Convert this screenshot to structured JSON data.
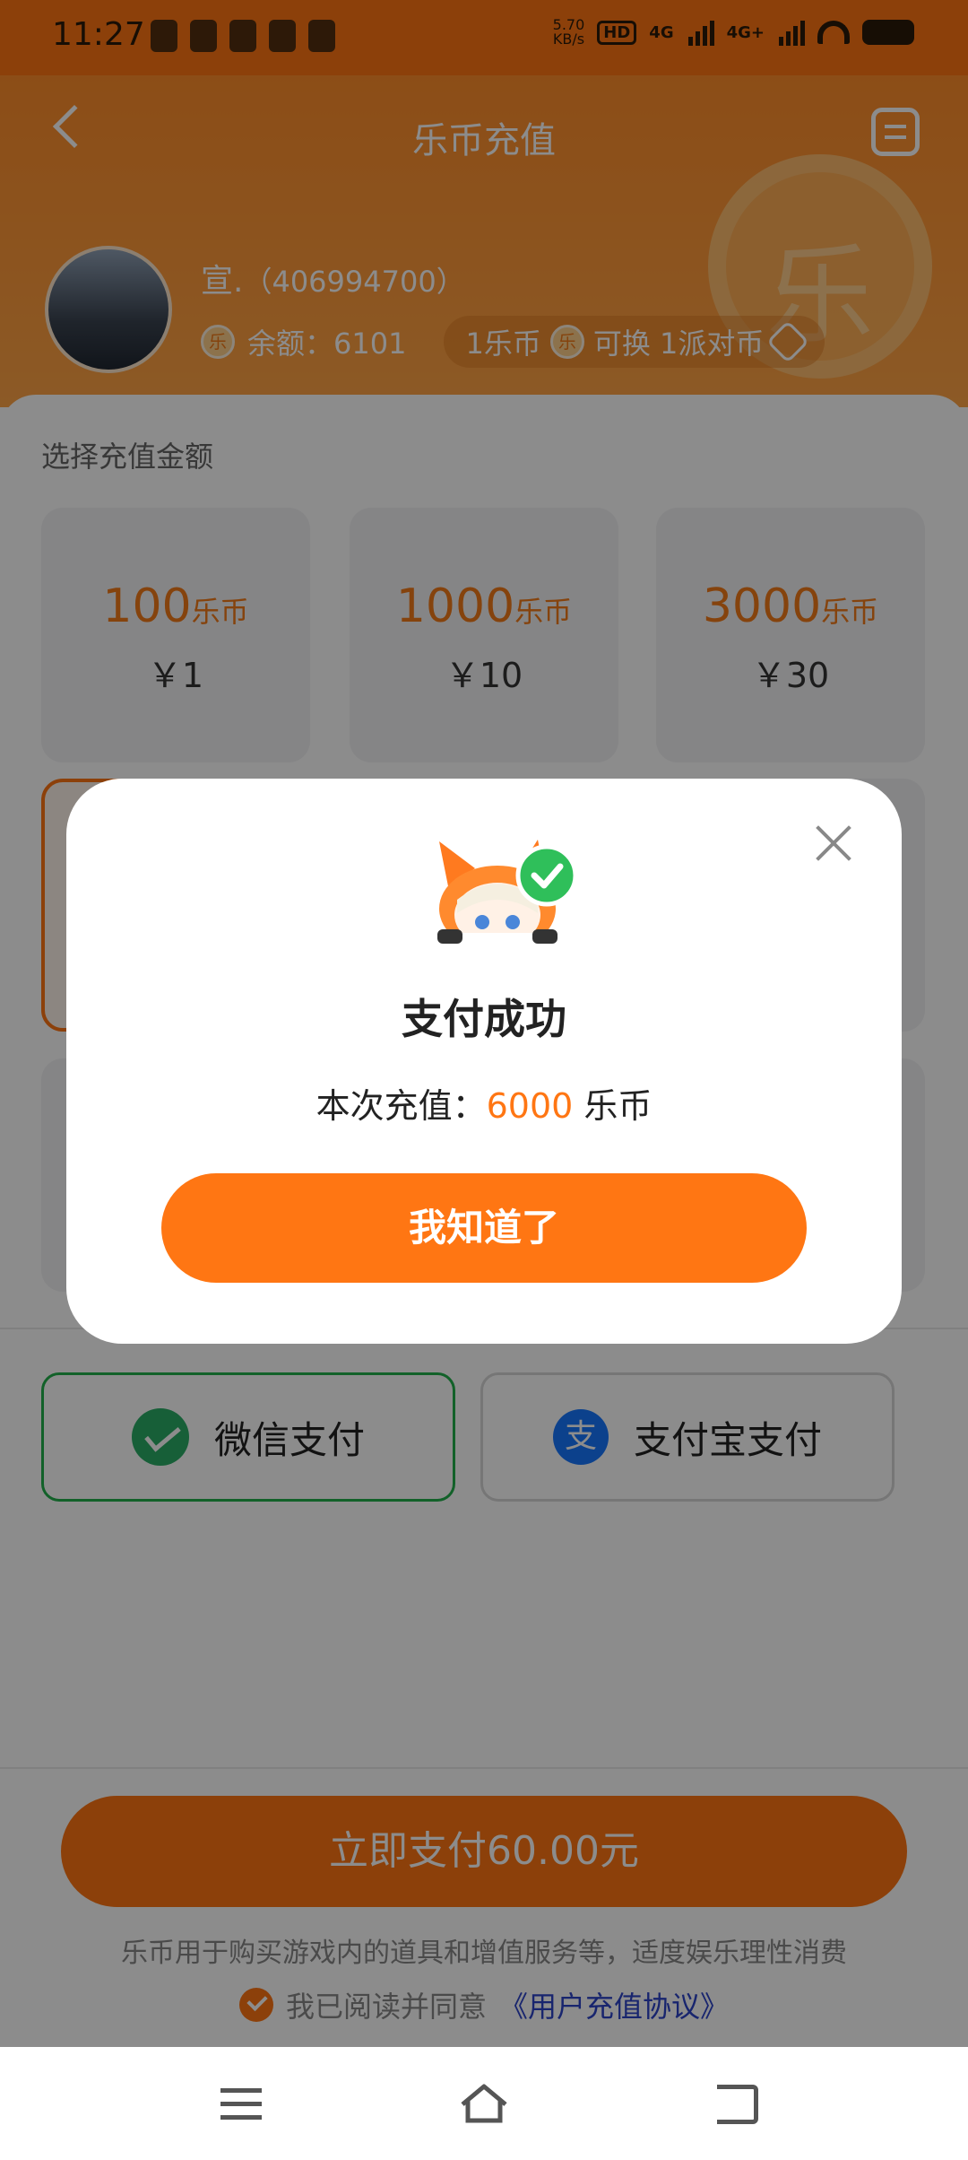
{
  "status_bar": {
    "time": "11:27",
    "net_speed_value": "5.70",
    "net_speed_unit": "KB/s",
    "hd_label": "HD",
    "sim1_label": "4G",
    "sim2_label": "4G+"
  },
  "header": {
    "title": "乐币充值",
    "username": "宣.",
    "user_id": "（406994700）",
    "balance_label": "余额：6101",
    "exchange_text_1": "1乐币",
    "exchange_text_2": "可换 1派对币",
    "coin_char": "乐",
    "big_coin_char": "乐"
  },
  "main": {
    "section_label": "选择充值金额",
    "amounts": [
      {
        "coins": "100",
        "unit": "乐币",
        "price": "￥1"
      },
      {
        "coins": "1000",
        "unit": "乐币",
        "price": "￥10"
      },
      {
        "coins": "3000",
        "unit": "乐币",
        "price": "￥30"
      }
    ],
    "payment_methods": {
      "wechat_label": "微信支付",
      "alipay_label": "支付宝支付",
      "alipay_icon_char": "支"
    },
    "pay_button_label": "立即支付60.00元",
    "disclaimer": "乐币用于购买游戏内的道具和增值服务等，适度娱乐理性消费",
    "agree_text": "我已阅读并同意",
    "agree_link": "《用户充值协议》"
  },
  "dialog": {
    "title": "支付成功",
    "msg_prefix": "本次充值：",
    "msg_amount": "6000",
    "msg_suffix": " 乐币",
    "button_label": "我知道了"
  },
  "colors": {
    "accent": "#ff7613",
    "wechat": "#2aae67",
    "alipay": "#1677ff",
    "link": "#2d44c9"
  }
}
